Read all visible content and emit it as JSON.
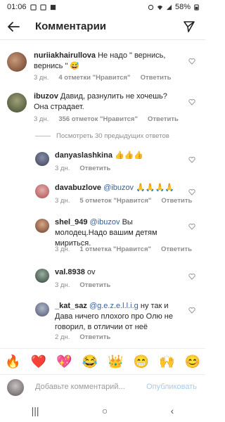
{
  "status_bar": {
    "time": "01:06",
    "battery": "58%"
  },
  "header": {
    "title": "Комментарии"
  },
  "comments": [
    {
      "user": "nuriiakhairullova",
      "text": "Не надо \" вернись, вернись \" 😅",
      "age": "3 дн.",
      "likes": "4 отметки \"Нравится\"",
      "reply": "Ответить"
    },
    {
      "user": "ibuzov",
      "text": "Давид, разнулить не хочешь? Она страдает.",
      "age": "3 дн.",
      "likes": "356 отметок \"Нравится\"",
      "reply": "Ответить"
    }
  ],
  "view_replies": "Посмотреть 30 предыдущих ответов",
  "replies": [
    {
      "user": "danyaslashkina",
      "mention": "",
      "text": "👍👍👍",
      "age": "3 дн.",
      "likes": "",
      "reply": "Ответить"
    },
    {
      "user": "davabuzlove",
      "mention": "@ibuzov",
      "text": "🙏🙏🙏🙏",
      "age": "3 дн.",
      "likes": "5 отметок \"Нравится\"",
      "reply": "Ответить"
    },
    {
      "user": "shel_949",
      "mention": "@ibuzov",
      "text": "Вы молодец.Надо вашим детям мириться.",
      "age": "3 дн.",
      "likes": "1 отметка \"Нравится\"",
      "reply": "Ответить"
    },
    {
      "user": "val.8938",
      "mention": "",
      "text": "ov",
      "age": "3 дн.",
      "likes": "",
      "reply": "Ответить"
    },
    {
      "user": "_kat_saz",
      "mention": "@g.e.z.e.l.l.i.g",
      "text": "ну так и Дава ничего плохого про Олю не говорил, в отличии от неё",
      "age": "2 дн.",
      "likes": "",
      "reply": "Ответить"
    }
  ],
  "emoji_bar": [
    "🔥",
    "❤️",
    "💖",
    "😂",
    "👑",
    "😁",
    "🙌",
    "😊"
  ],
  "composer": {
    "placeholder": "Добавьте комментарий...",
    "publish": "Опубликовать"
  },
  "nav": {
    "recent": "|||",
    "home": "○",
    "back": "‹"
  }
}
